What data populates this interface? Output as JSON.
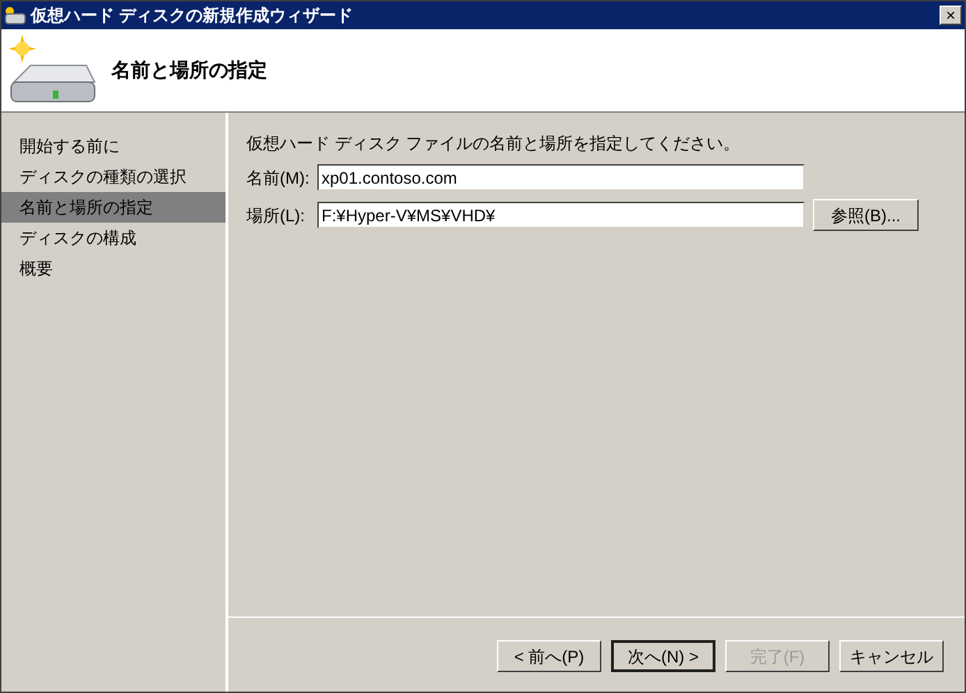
{
  "window": {
    "title": "仮想ハード ディスクの新規作成ウィザード",
    "close": "×"
  },
  "header": {
    "title": "名前と場所の指定"
  },
  "sidebar": {
    "items": [
      {
        "label": "開始する前に",
        "selected": false
      },
      {
        "label": "ディスクの種類の選択",
        "selected": false
      },
      {
        "label": "名前と場所の指定",
        "selected": true
      },
      {
        "label": "ディスクの構成",
        "selected": false
      },
      {
        "label": "概要",
        "selected": false
      }
    ]
  },
  "content": {
    "instruction": "仮想ハード ディスク ファイルの名前と場所を指定してください。",
    "fields": [
      {
        "label": "名前(M):",
        "value": "xp01.contoso.com"
      },
      {
        "label": "場所(L):",
        "value": "F:¥Hyper-V¥MS¥VHD¥",
        "button": "参照(B)..."
      }
    ]
  },
  "buttons": [
    {
      "label": "< 前へ(P)",
      "disabled": false,
      "default": false
    },
    {
      "label": "次へ(N) >",
      "disabled": false,
      "default": true
    },
    {
      "label": "完了(F)",
      "disabled": true,
      "default": false
    },
    {
      "label": "キャンセル",
      "disabled": false,
      "default": false
    }
  ]
}
